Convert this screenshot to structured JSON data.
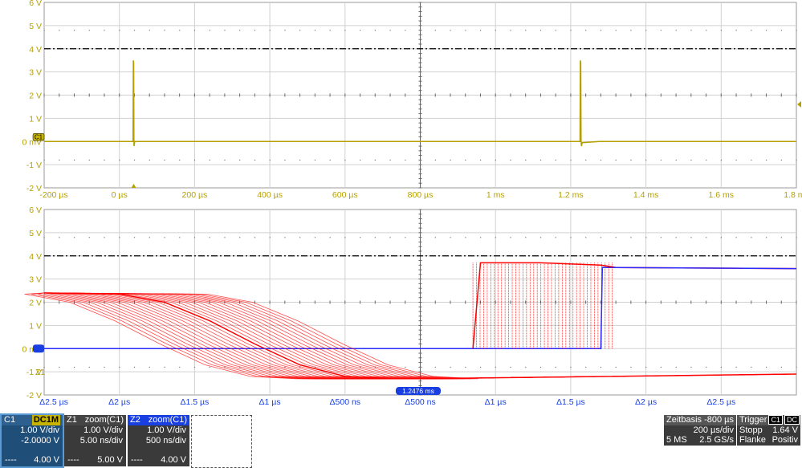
{
  "top_panel": {
    "y_ticks": [
      "6 V",
      "5 V",
      "4 V",
      "3 V",
      "2 V",
      "1 V",
      "0 mV",
      "-1 V",
      "-2 V"
    ],
    "x_ticks": [
      "-200 µs",
      "0 µs",
      "200 µs",
      "400 µs",
      "600 µs",
      "800 µs",
      "1 ms",
      "1.2 ms",
      "1.4 ms",
      "1.6 ms",
      "1.8 ms"
    ],
    "channel_marker": "C1"
  },
  "bottom_panel": {
    "y_ticks": [
      "6 V",
      "5 V",
      "4 V",
      "3 V",
      "2 V",
      "1 V",
      "0 mV",
      "-1 V",
      "-2 V"
    ],
    "x_ticks": [
      "Δ2.5 µs",
      "Δ2 µs",
      "Δ1.5 µs",
      "Δ1 µs",
      "Δ500 ns",
      "Δ500 ns",
      "Δ1 µs",
      "Δ1.5 µs",
      "Δ2 µs",
      "Δ2.5 µs"
    ],
    "center_marker": "1.2476 ms",
    "zoom_marker": "Z1"
  },
  "chart_data": [
    {
      "type": "line",
      "title": "",
      "xlabel": "",
      "ylabel": "",
      "x_unit": "µs",
      "xlim": [
        -250,
        1850
      ],
      "ylim": [
        -2,
        6
      ],
      "grid": true,
      "trigger_level_V": 4.0,
      "series": [
        {
          "color": "#b5a000",
          "x": [
            -250,
            -2,
            -1,
            0,
            0.5,
            1,
            2,
            3,
            50,
            1246,
            1247,
            1248,
            1249,
            1250,
            1252,
            1300,
            1850
          ],
          "y": [
            0,
            0,
            3.5,
            3.4,
            0,
            -0.2,
            -0.1,
            0,
            0,
            0,
            3.5,
            3.4,
            0,
            -0.2,
            -0.05,
            0,
            0
          ]
        }
      ]
    },
    {
      "type": "line",
      "title": "",
      "xlabel": "",
      "ylabel": "",
      "x_unit": "µs relative to 1.2476 ms",
      "xlim": [
        -2.5,
        2.5
      ],
      "ylim": [
        -2,
        6
      ],
      "grid": true,
      "trigger_level_V": 4.0,
      "series": [
        {
          "color": "#ff0000",
          "x": [
            -2.5,
            -2.0,
            -1.7,
            -1.4,
            -1.1,
            -0.8,
            -0.5,
            -0.2,
            0.0,
            2.5
          ],
          "y": [
            2.4,
            2.35,
            2.0,
            1.2,
            0.2,
            -0.7,
            -1.2,
            -1.3,
            -1.3,
            -1.1
          ]
        },
        {
          "color": "#ff0000",
          "x": [
            0.35,
            0.4,
            0.8,
            1.2,
            1.3,
            2.5
          ],
          "y": [
            0,
            3.7,
            3.7,
            3.6,
            3.5,
            3.45
          ]
        },
        {
          "color": "#2a2aff",
          "x": [
            -2.5,
            0,
            1.2,
            1.21,
            2.5
          ],
          "y": [
            0,
            0,
            0,
            3.5,
            3.45
          ]
        }
      ]
    }
  ],
  "info": {
    "c1": {
      "name": "C1",
      "coupling": "DC1M",
      "vdiv": "1.00 V/div",
      "offset": "-2.0000 V",
      "foot_left": "----",
      "foot_right": "4.00 V"
    },
    "z1": {
      "name": "Z1",
      "source": "zoom(C1)",
      "vdiv": "1.00 V/div",
      "tdiv": "5.00 ns/div",
      "foot_left": "----",
      "foot_right": "5.00 V"
    },
    "z2": {
      "name": "Z2",
      "source": "zoom(C1)",
      "vdiv": "1.00 V/div",
      "tdiv": "500 ns/div",
      "foot_left": "----",
      "foot_right": "4.00 V"
    },
    "timebase": {
      "title": "Zeitbasis",
      "delay": "-800 µs",
      "tdiv": "200 µs/div",
      "samples": "5 MS",
      "rate": "2.5 GS/s"
    },
    "trigger": {
      "title": "Trigger",
      "tag1": "C1",
      "tag2": "DC",
      "mode": "Stopp",
      "level": "1.64 V",
      "type": "Flanke",
      "slope": "Positiv"
    }
  }
}
